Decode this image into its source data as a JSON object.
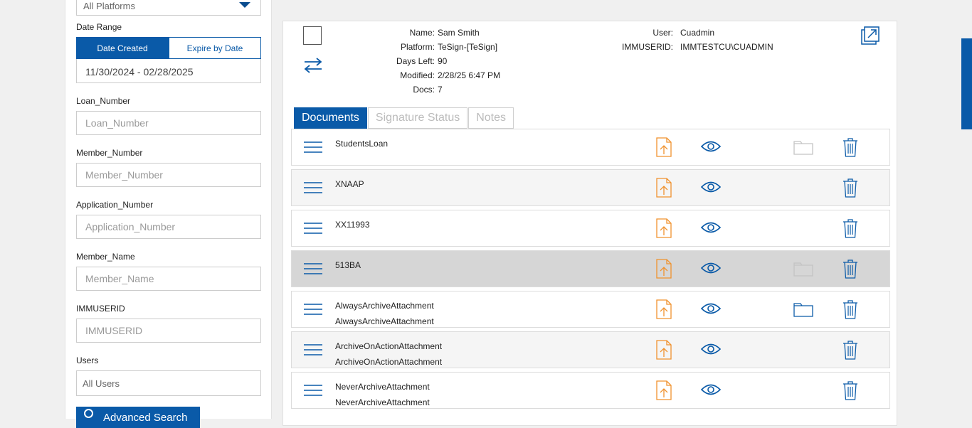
{
  "filters": {
    "platform_value": "All Platforms",
    "date_range_label": "Date Range",
    "date_created_label": "Date Created",
    "expire_by_date_label": "Expire by Date",
    "date_range_value": "11/30/2024 - 02/28/2025",
    "fields": [
      {
        "label": "Loan_Number",
        "placeholder": "Loan_Number"
      },
      {
        "label": "Member_Number",
        "placeholder": "Member_Number"
      },
      {
        "label": "Application_Number",
        "placeholder": "Application_Number"
      },
      {
        "label": "Member_Name",
        "placeholder": "Member_Name"
      },
      {
        "label": "IMMUSERID",
        "placeholder": "IMMUSERID"
      }
    ],
    "users_label": "Users",
    "users_value": "All Users",
    "advanced_search_label": "Advanced Search"
  },
  "package": {
    "left": [
      {
        "key": "Name:",
        "value": "Sam Smith"
      },
      {
        "key": "Platform:",
        "value": "TeSign-[TeSign]"
      },
      {
        "key": "Days Left:",
        "value": "90"
      },
      {
        "key": "Modified:",
        "value": "2/28/25 6:47 PM"
      },
      {
        "key": "Docs:",
        "value": "7"
      }
    ],
    "right": [
      {
        "key": "User:",
        "value": "Cuadmin"
      },
      {
        "key": "IMMUSERID:",
        "value": "IMMTESTCU\\CUADMIN"
      }
    ]
  },
  "tabs": [
    "Documents",
    "Signature Status",
    "Notes"
  ],
  "documents": [
    {
      "line1": "StudentsLoan",
      "line2": "",
      "folder": "faded"
    },
    {
      "line1": "XNAAP",
      "line2": "",
      "folder": "none"
    },
    {
      "line1": "XX11993",
      "line2": "",
      "folder": "none"
    },
    {
      "line1": "513BA",
      "line2": "",
      "folder": "faded"
    },
    {
      "line1": "AlwaysArchiveAttachment",
      "line2": "AlwaysArchiveAttachment",
      "folder": "active"
    },
    {
      "line1": "ArchiveOnActionAttachment",
      "line2": "ArchiveOnActionAttachment",
      "folder": "none"
    },
    {
      "line1": "NeverArchiveAttachment",
      "line2": "NeverArchiveAttachment",
      "folder": "none"
    }
  ],
  "colors": {
    "accent": "#0a5aa8",
    "upload": "#f0922e",
    "selected_row": "#d6d6d6"
  }
}
